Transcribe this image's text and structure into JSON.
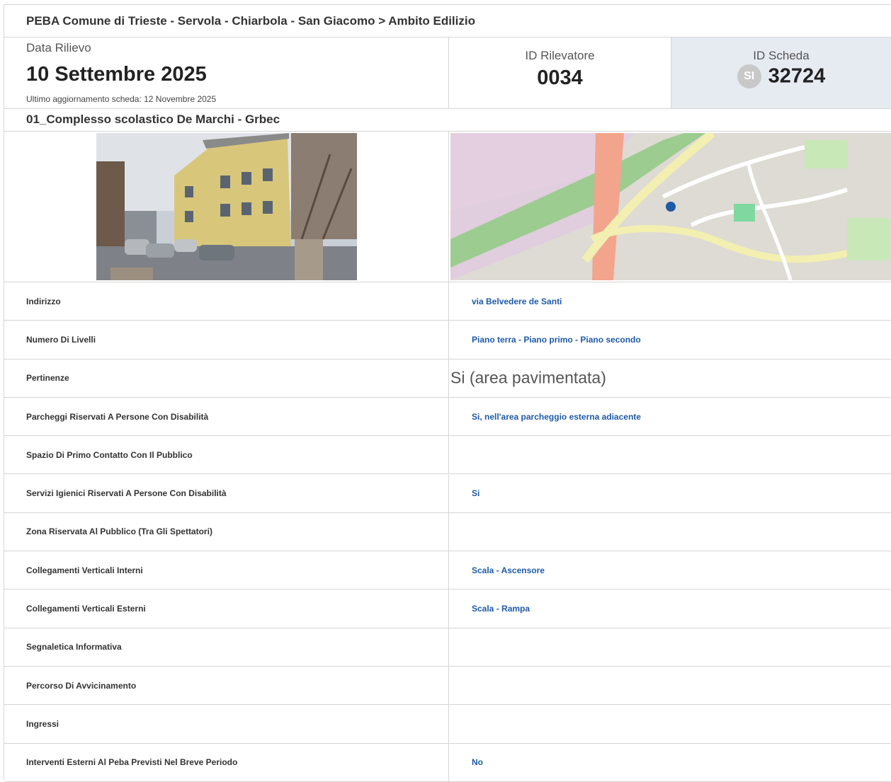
{
  "breadcrumb": "PEBA Comune di Trieste - Servola - Chiarbola - San Giacomo > Ambito Edilizio",
  "survey": {
    "date_label": "Data Rilievo",
    "date_value": "10 Settembre 2025",
    "last_update": "Ultimo aggiornamento scheda: 12 Novembre 2025"
  },
  "surveyor": {
    "label": "ID Rilevatore",
    "value": "0034"
  },
  "sheet": {
    "label": "ID Scheda",
    "badge": "SI",
    "value": "32724"
  },
  "building_name": "01_Complesso scolastico De Marchi - Grbec",
  "fields": [
    {
      "label": "Indirizzo",
      "value": "via Belvedere de Santi"
    },
    {
      "label": "Numero Di Livelli",
      "value": "Piano terra - Piano primo - Piano secondo"
    },
    {
      "label": "Pertinenze",
      "value": "Si (area pavimentata)"
    },
    {
      "label": "Parcheggi Riservati A Persone Con Disabilità",
      "value": "Si, nell'area parcheggio esterna adiacente"
    },
    {
      "label": "Spazio Di Primo Contatto Con Il Pubblico",
      "value": ""
    },
    {
      "label": "Servizi Igienici Riservati A Persone Con Disabilità",
      "value": "Si"
    },
    {
      "label": "Zona Riservata Al Pubblico (Tra Gli Spettatori)",
      "value": ""
    },
    {
      "label": "Collegamenti Verticali Interni",
      "value": "Scala - Ascensore"
    },
    {
      "label": "Collegamenti Verticali Esterni",
      "value": "Scala - Rampa"
    },
    {
      "label": "Segnaletica Informativa",
      "value": ""
    },
    {
      "label": "Percorso Di Avvicinamento",
      "value": ""
    },
    {
      "label": "Ingressi",
      "value": ""
    },
    {
      "label": "Interventi Esterni Al Peba Previsti Nel Breve Periodo",
      "value": "No"
    }
  ],
  "colors": {
    "link": "#1f5aa6",
    "border": "#d6d6d6",
    "highlight": "#e6ebf2"
  }
}
